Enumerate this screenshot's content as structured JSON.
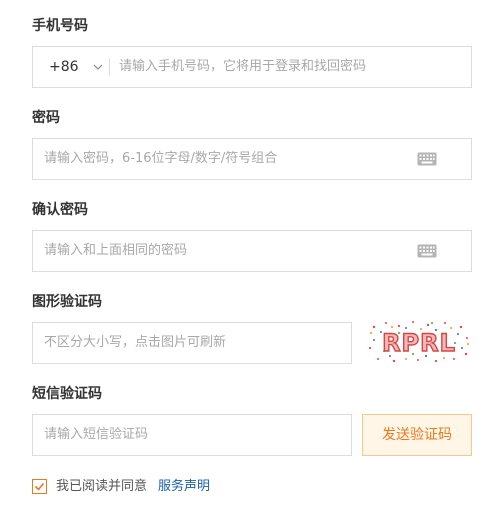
{
  "phone": {
    "label": "手机号码",
    "country_code": "+86",
    "placeholder": "请输入手机号码，它将用于登录和找回密码"
  },
  "password": {
    "label": "密码",
    "placeholder": "请输入密码，6-16位字母/数字/符号组合"
  },
  "confirm_password": {
    "label": "确认密码",
    "placeholder": "请输入和上面相同的密码"
  },
  "image_captcha": {
    "label": "图形验证码",
    "placeholder": "不区分大小写，点击图片可刷新",
    "captcha_text": "RPRL"
  },
  "sms_code": {
    "label": "短信验证码",
    "placeholder": "请输入短信验证码",
    "send_button": "发送验证码"
  },
  "agreement": {
    "checked": true,
    "text": "我已阅读并同意",
    "link": "服务声明"
  },
  "colors": {
    "accent": "#e97b1e",
    "link": "#1b5fa8",
    "border": "#dcdcdc",
    "placeholder": "#a8a8a8"
  }
}
